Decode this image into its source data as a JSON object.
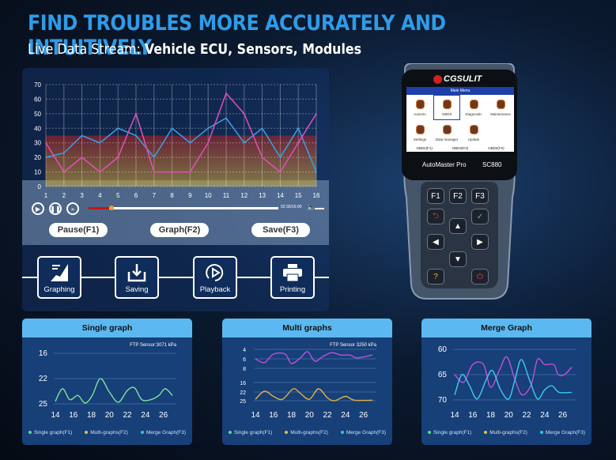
{
  "header": {
    "title": "FIND TROUBLES MORE ACCURATELY AND INTUITIVELY",
    "subtitle_lead": "Live Data Stream: ",
    "subtitle_bold": "Vehicle ECU, Sensors, Modules"
  },
  "colors": {
    "accent": "#2f9be8",
    "series_blue": "#3aa0e6",
    "series_pink": "#e050b8",
    "card_header": "#5cb8f0",
    "card_bg": "#173f78"
  },
  "chart_data": [
    {
      "type": "line",
      "title": "",
      "x": [
        1,
        2,
        3,
        4,
        5,
        6,
        7,
        8,
        9,
        10,
        11,
        12,
        13,
        14,
        15,
        16
      ],
      "ylim": [
        0,
        70
      ],
      "yticks": [
        0,
        10,
        20,
        30,
        40,
        50,
        60,
        70
      ],
      "grid": true,
      "series": [
        {
          "color": "#3aa0e6",
          "values": [
            20,
            23,
            35,
            30,
            40,
            35,
            20,
            40,
            30,
            40,
            47,
            30,
            40,
            20,
            40,
            10
          ]
        },
        {
          "color": "#e050b8",
          "values": [
            30,
            10,
            20,
            10,
            20,
            50,
            10,
            10,
            10,
            30,
            64,
            50,
            20,
            10,
            30,
            50
          ]
        }
      ],
      "bands": [
        {
          "from": 0,
          "to": 35,
          "color": "red/yellow"
        }
      ]
    },
    {
      "type": "line",
      "title": "Single graph",
      "annotation": "FTP Sensor:3071 kPa",
      "xticks": [
        14,
        16,
        18,
        20,
        22,
        24,
        26
      ],
      "yticks": [
        16,
        22,
        25
      ],
      "series": [
        {
          "color": "#7de39a",
          "points": [
            [
              14,
              24.7
            ],
            [
              14.8,
              23.2
            ],
            [
              15.6,
              24.5
            ],
            [
              16.5,
              24
            ],
            [
              17.3,
              24.9
            ],
            [
              18.1,
              24
            ],
            [
              19,
              22
            ],
            [
              20,
              23.6
            ],
            [
              21,
              24.8
            ],
            [
              22,
              23.4
            ],
            [
              22.8,
              23.1
            ],
            [
              23.6,
              24.5
            ],
            [
              24.6,
              24.5
            ],
            [
              25.5,
              24
            ],
            [
              26.2,
              23.2
            ],
            [
              27,
              24
            ]
          ]
        }
      ],
      "legend": [
        "Single graph(F1)",
        "Multi-graphs(F2)",
        "Merge Graph(F3)"
      ]
    },
    {
      "type": "line",
      "title": "Multi graphs",
      "annotation": "FTP Sensor 3250 kPa",
      "xticks": [
        14,
        16,
        18,
        20,
        22,
        24,
        26
      ],
      "yticks": [
        4,
        6,
        8,
        16,
        22,
        25
      ],
      "series": [
        {
          "color": "#c050d8",
          "points": [
            [
              14,
              6
            ],
            [
              15,
              6.8
            ],
            [
              16,
              5
            ],
            [
              17.3,
              5
            ],
            [
              18,
              7
            ],
            [
              19,
              5.8
            ],
            [
              19.8,
              4.5
            ],
            [
              20.6,
              6.5
            ],
            [
              21.5,
              5.5
            ],
            [
              22.5,
              4.7
            ],
            [
              23.5,
              5.2
            ],
            [
              24.5,
              5.2
            ],
            [
              25.3,
              5.8
            ],
            [
              27,
              5.2
            ]
          ]
        },
        {
          "color": "#e0b040",
          "points": [
            [
              14,
              24.5
            ],
            [
              15,
              21.5
            ],
            [
              16,
              23.5
            ],
            [
              17,
              24.5
            ],
            [
              18.2,
              20
            ],
            [
              19,
              22.5
            ],
            [
              20,
              24.5
            ],
            [
              21,
              20
            ],
            [
              22,
              24
            ],
            [
              22.8,
              25
            ],
            [
              24,
              23.5
            ],
            [
              25,
              24.8
            ],
            [
              27,
              24.8
            ]
          ]
        }
      ],
      "legend": [
        "Single graph(F1)",
        "Multi-graphs(F2)",
        "Merge Graph(F3)"
      ]
    },
    {
      "type": "line",
      "title": "Merge Graph",
      "xticks": [
        14,
        16,
        18,
        20,
        22,
        24,
        26
      ],
      "yticks": [
        60,
        65,
        70
      ],
      "series": [
        {
          "color": "#c050d8",
          "points": [
            [
              14,
              65
            ],
            [
              15,
              66.5
            ],
            [
              16,
              63
            ],
            [
              17.2,
              63
            ],
            [
              18,
              67.5
            ],
            [
              19,
              64
            ],
            [
              19.8,
              61.5
            ],
            [
              20.7,
              66
            ],
            [
              21.5,
              69
            ],
            [
              22.5,
              67
            ],
            [
              23.2,
              62
            ],
            [
              24,
              63
            ],
            [
              25,
              63
            ],
            [
              25.5,
              65
            ],
            [
              26.2,
              65
            ],
            [
              27,
              63.5
            ]
          ]
        },
        {
          "color": "#40c8f0",
          "points": [
            [
              14,
              69
            ],
            [
              14.8,
              65
            ],
            [
              15.6,
              67
            ],
            [
              16.5,
              69.8
            ],
            [
              17.5,
              66
            ],
            [
              18.2,
              64.2
            ],
            [
              19.1,
              68
            ],
            [
              20,
              69.8
            ],
            [
              20.7,
              66
            ],
            [
              21.4,
              62
            ],
            [
              22.3,
              66
            ],
            [
              23.2,
              69.8
            ],
            [
              24,
              68
            ],
            [
              24.8,
              67.2
            ],
            [
              25.6,
              68.5
            ],
            [
              27,
              68.5
            ]
          ]
        }
      ],
      "legend": [
        "Single graph(F1)",
        "Multi-graphs(F2)",
        "Merge Graph(F3)"
      ]
    }
  ],
  "player": {
    "time": "02:30/15:00",
    "progress": 0.05,
    "buttons": [
      {
        "label": "Pause(F1)"
      },
      {
        "label": "Graph(F2)"
      },
      {
        "label": "Save(F3)"
      }
    ]
  },
  "features": [
    {
      "label": "Graphing",
      "icon": "chart-icon"
    },
    {
      "label": "Saving",
      "icon": "download-icon"
    },
    {
      "label": "Playback",
      "icon": "replay-icon"
    },
    {
      "label": "Printing",
      "icon": "printer-icon"
    }
  ],
  "device": {
    "brand": "CGSULIT",
    "screen_title": "Main Menu",
    "menu": [
      "AutoVin",
      "OBDII",
      "Diagnostic",
      "Maintenance",
      "Settings",
      "Data manager",
      "Update"
    ],
    "fkeys": [
      "OBDII(F1)",
      "OBDII(F2)",
      "OBDII(F3)"
    ],
    "model_name": "AutoMaster Pro",
    "model_code": "SC880",
    "keys": [
      "F1",
      "F2",
      "F3"
    ]
  }
}
